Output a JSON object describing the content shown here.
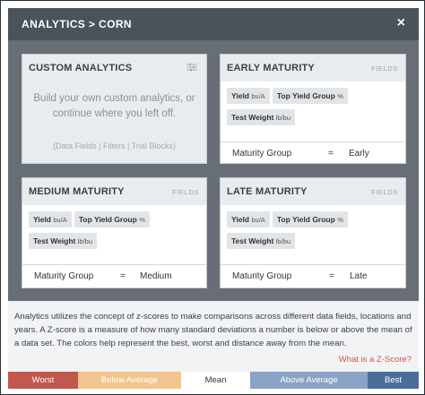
{
  "header": {
    "title": "ANALYTICS > CORN",
    "close": "×"
  },
  "custom_card": {
    "title": "CUSTOM ANALYTICS",
    "icon": "adjust-icon",
    "prompt_line1": "Build your own custom analytics, or",
    "prompt_line2": "continue where you left off.",
    "hint": "(Data Fields | Filters | Trial Blocks)"
  },
  "early_card": {
    "title": "EARLY MATURITY",
    "meta": "FIELDS",
    "chips": [
      {
        "label": "Yield",
        "unit": "bu/A"
      },
      {
        "label": "Top Yield Group",
        "unit": "%"
      },
      {
        "label": "Test Weight",
        "unit": "lb/bu"
      }
    ],
    "row": {
      "label": "Maturity Group",
      "eq": "=",
      "value": "Early"
    }
  },
  "medium_card": {
    "title": "MEDIUM MATURITY",
    "meta": "FIELDS",
    "chips": [
      {
        "label": "Yield",
        "unit": "bu/A"
      },
      {
        "label": "Top Yield Group",
        "unit": "%"
      },
      {
        "label": "Test Weight",
        "unit": "lb/bu"
      }
    ],
    "row": {
      "label": "Maturity Group",
      "eq": "=",
      "value": "Medium"
    }
  },
  "late_card": {
    "title": "LATE MATURITY",
    "meta": "FIELDS",
    "chips": [
      {
        "label": "Yield",
        "unit": "bu/A"
      },
      {
        "label": "Top Yield Group",
        "unit": "%"
      },
      {
        "label": "Test Weight",
        "unit": "lb/bu"
      }
    ],
    "row": {
      "label": "Maturity Group",
      "eq": "=",
      "value": "Late"
    }
  },
  "info": {
    "text": "Analytics utilizes the concept of z-scores to make comparisons across different data fields, locations and years. A Z-score is a measure of how many standard deviations a number is below or above the mean of a data set. The colors help represent the best, worst and distance away from the mean.",
    "link": "What is a Z-Score?"
  },
  "legend": {
    "worst": "Worst",
    "below": "Below Average",
    "mean": "Mean",
    "above": "Above Average",
    "best": "Best",
    "colors": {
      "worst": "#c1574d",
      "below": "#f2c58f",
      "mean": "#ffffff",
      "above": "#8aa3c6",
      "best": "#4b6d9b"
    }
  }
}
